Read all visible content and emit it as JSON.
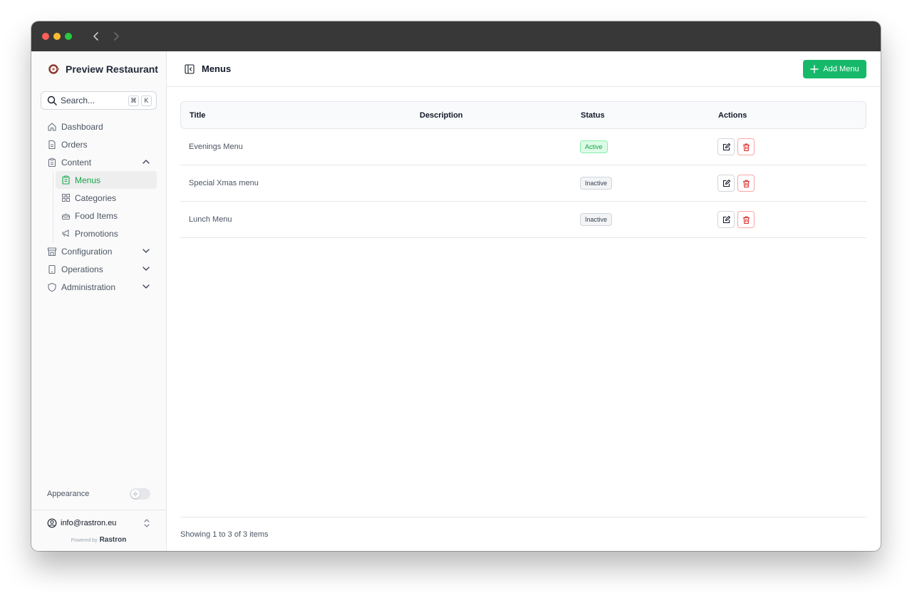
{
  "app": {
    "name": "Preview Restaurant"
  },
  "search": {
    "placeholder": "Search...",
    "shortcut_keys": [
      "⌘",
      "K"
    ]
  },
  "sidebar": {
    "items": [
      {
        "label": "Dashboard",
        "icon": "home-icon"
      },
      {
        "label": "Orders",
        "icon": "document-icon"
      },
      {
        "label": "Content",
        "icon": "clipboard-icon",
        "expanded": true
      },
      {
        "label": "Configuration",
        "icon": "store-icon",
        "expanded": false
      },
      {
        "label": "Operations",
        "icon": "tablet-icon",
        "expanded": false
      },
      {
        "label": "Administration",
        "icon": "shield-icon",
        "expanded": false
      }
    ],
    "content_children": [
      {
        "label": "Menus",
        "icon": "clipboard-list-icon",
        "active": true
      },
      {
        "label": "Categories",
        "icon": "grid-icon"
      },
      {
        "label": "Food Items",
        "icon": "cake-icon"
      },
      {
        "label": "Promotions",
        "icon": "megaphone-icon"
      }
    ],
    "appearance_label": "Appearance",
    "appearance_dark_mode": false,
    "account_email": "info@rastron.eu",
    "powered_by": "Powered by",
    "powered_brand": "Rastron"
  },
  "page": {
    "title": "Menus",
    "add_button_label": "Add Menu"
  },
  "table": {
    "columns": [
      "Title",
      "Description",
      "Status",
      "Actions"
    ],
    "rows": [
      {
        "title": "Evenings Menu",
        "description": "",
        "status": "Active"
      },
      {
        "title": "Special Xmas menu",
        "description": "",
        "status": "Inactive"
      },
      {
        "title": "Lunch Menu",
        "description": "",
        "status": "Inactive"
      }
    ],
    "footer_text": "Showing 1 to 3 of 3 items"
  },
  "colors": {
    "accent": "#16b96a",
    "active_text": "#16a34a",
    "danger": "#dc2626"
  }
}
